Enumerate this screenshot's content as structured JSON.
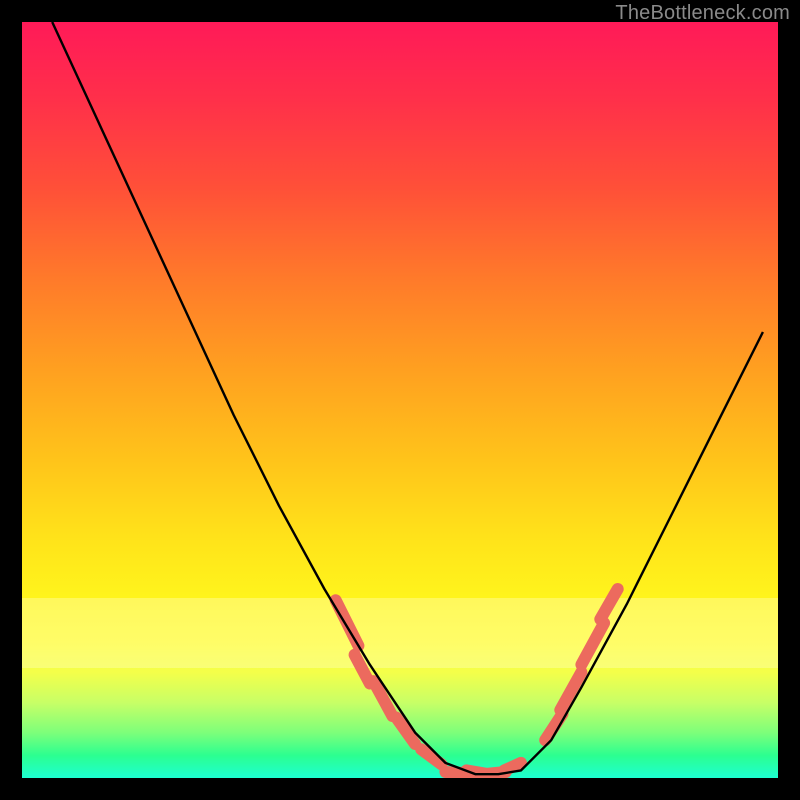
{
  "watermark": "TheBottleneck.com",
  "chart_data": {
    "type": "line",
    "title": "",
    "xlabel": "",
    "ylabel": "",
    "xlim": [
      0,
      1
    ],
    "ylim": [
      0,
      1
    ],
    "grid": false,
    "series": [
      {
        "name": "bottleneck-curve",
        "color": "#000000",
        "x": [
          0.04,
          0.1,
          0.16,
          0.22,
          0.28,
          0.34,
          0.4,
          0.46,
          0.52,
          0.56,
          0.6,
          0.63,
          0.66,
          0.7,
          0.74,
          0.8,
          0.86,
          0.92,
          0.98
        ],
        "y": [
          1.0,
          0.87,
          0.74,
          0.61,
          0.48,
          0.36,
          0.25,
          0.15,
          0.06,
          0.02,
          0.005,
          0.005,
          0.01,
          0.05,
          0.12,
          0.23,
          0.35,
          0.47,
          0.59
        ]
      }
    ],
    "overlay_segments": {
      "name": "coral-dash-highlights",
      "color": "#ec6a5e",
      "width": 12,
      "segments": [
        {
          "x0": 0.415,
          "y0": 0.235,
          "x1": 0.445,
          "y1": 0.175
        },
        {
          "x0": 0.44,
          "y0": 0.163,
          "x1": 0.46,
          "y1": 0.125
        },
        {
          "x0": 0.465,
          "y0": 0.128,
          "x1": 0.49,
          "y1": 0.082
        },
        {
          "x0": 0.495,
          "y0": 0.08,
          "x1": 0.52,
          "y1": 0.045
        },
        {
          "x0": 0.528,
          "y0": 0.038,
          "x1": 0.555,
          "y1": 0.018
        },
        {
          "x0": 0.56,
          "y0": 0.008,
          "x1": 0.598,
          "y1": 0.006
        },
        {
          "x0": 0.6,
          "y0": 0.004,
          "x1": 0.64,
          "y1": 0.008
        },
        {
          "x0": 0.588,
          "y0": 0.01,
          "x1": 0.612,
          "y1": 0.006
        },
        {
          "x0": 0.638,
          "y0": 0.01,
          "x1": 0.66,
          "y1": 0.02
        },
        {
          "x0": 0.692,
          "y0": 0.05,
          "x1": 0.715,
          "y1": 0.085
        },
        {
          "x0": 0.712,
          "y0": 0.09,
          "x1": 0.74,
          "y1": 0.14
        },
        {
          "x0": 0.74,
          "y0": 0.15,
          "x1": 0.77,
          "y1": 0.205
        },
        {
          "x0": 0.765,
          "y0": 0.21,
          "x1": 0.788,
          "y1": 0.25
        }
      ]
    },
    "background_gradient": {
      "top": "#ff1a58",
      "upper_mid": "#ffa020",
      "lower_mid": "#fff41c",
      "bottom": "#1dffd1"
    }
  }
}
